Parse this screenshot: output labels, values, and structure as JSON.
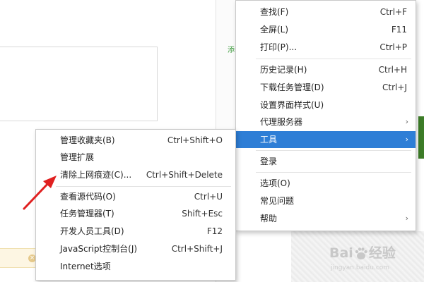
{
  "main_menu": {
    "group1": [
      {
        "label": "查找(F)",
        "shortcut": "Ctrl+F"
      },
      {
        "label": "全屏(L)",
        "shortcut": "F11"
      },
      {
        "label": "打印(P)...",
        "shortcut": "Ctrl+P"
      }
    ],
    "group2": [
      {
        "label": "历史记录(H)",
        "shortcut": "Ctrl+H"
      },
      {
        "label": "下载任务管理(D)",
        "shortcut": "Ctrl+J"
      },
      {
        "label": "设置界面样式(U)",
        "shortcut": ""
      },
      {
        "label": "代理服务器",
        "shortcut": ""
      },
      {
        "label": "工具",
        "shortcut": ""
      }
    ],
    "group3": [
      {
        "label": "登录"
      }
    ],
    "group4": [
      {
        "label": "选项(O)"
      },
      {
        "label": "常见问题"
      },
      {
        "label": "帮助"
      }
    ],
    "submenu_arrow": "›"
  },
  "tools_submenu": {
    "group1": [
      {
        "label": "管理收藏夹(B)",
        "shortcut": "Ctrl+Shift+O"
      },
      {
        "label": "管理扩展",
        "shortcut": ""
      },
      {
        "label": "清除上网痕迹(C)...",
        "shortcut": "Ctrl+Shift+Delete"
      }
    ],
    "group2": [
      {
        "label": "查看源代码(O)",
        "shortcut": "Ctrl+U"
      },
      {
        "label": "任务管理器(T)",
        "shortcut": "Shift+Esc"
      },
      {
        "label": "开发人员工具(D)",
        "shortcut": "F12"
      },
      {
        "label": "JavaScript控制台(J)",
        "shortcut": "Ctrl+Shift+J"
      },
      {
        "label": "Internet选项",
        "shortcut": ""
      }
    ]
  },
  "background": {
    "green_chars": "添",
    "notice_icon": "×"
  },
  "watermark": {
    "brand": "Bai",
    "brand_suffix": "经验",
    "sub": "jingyan.baidu.com"
  },
  "colors": {
    "highlight": "#2e7ed6",
    "annotation_arrow": "#e02020"
  }
}
